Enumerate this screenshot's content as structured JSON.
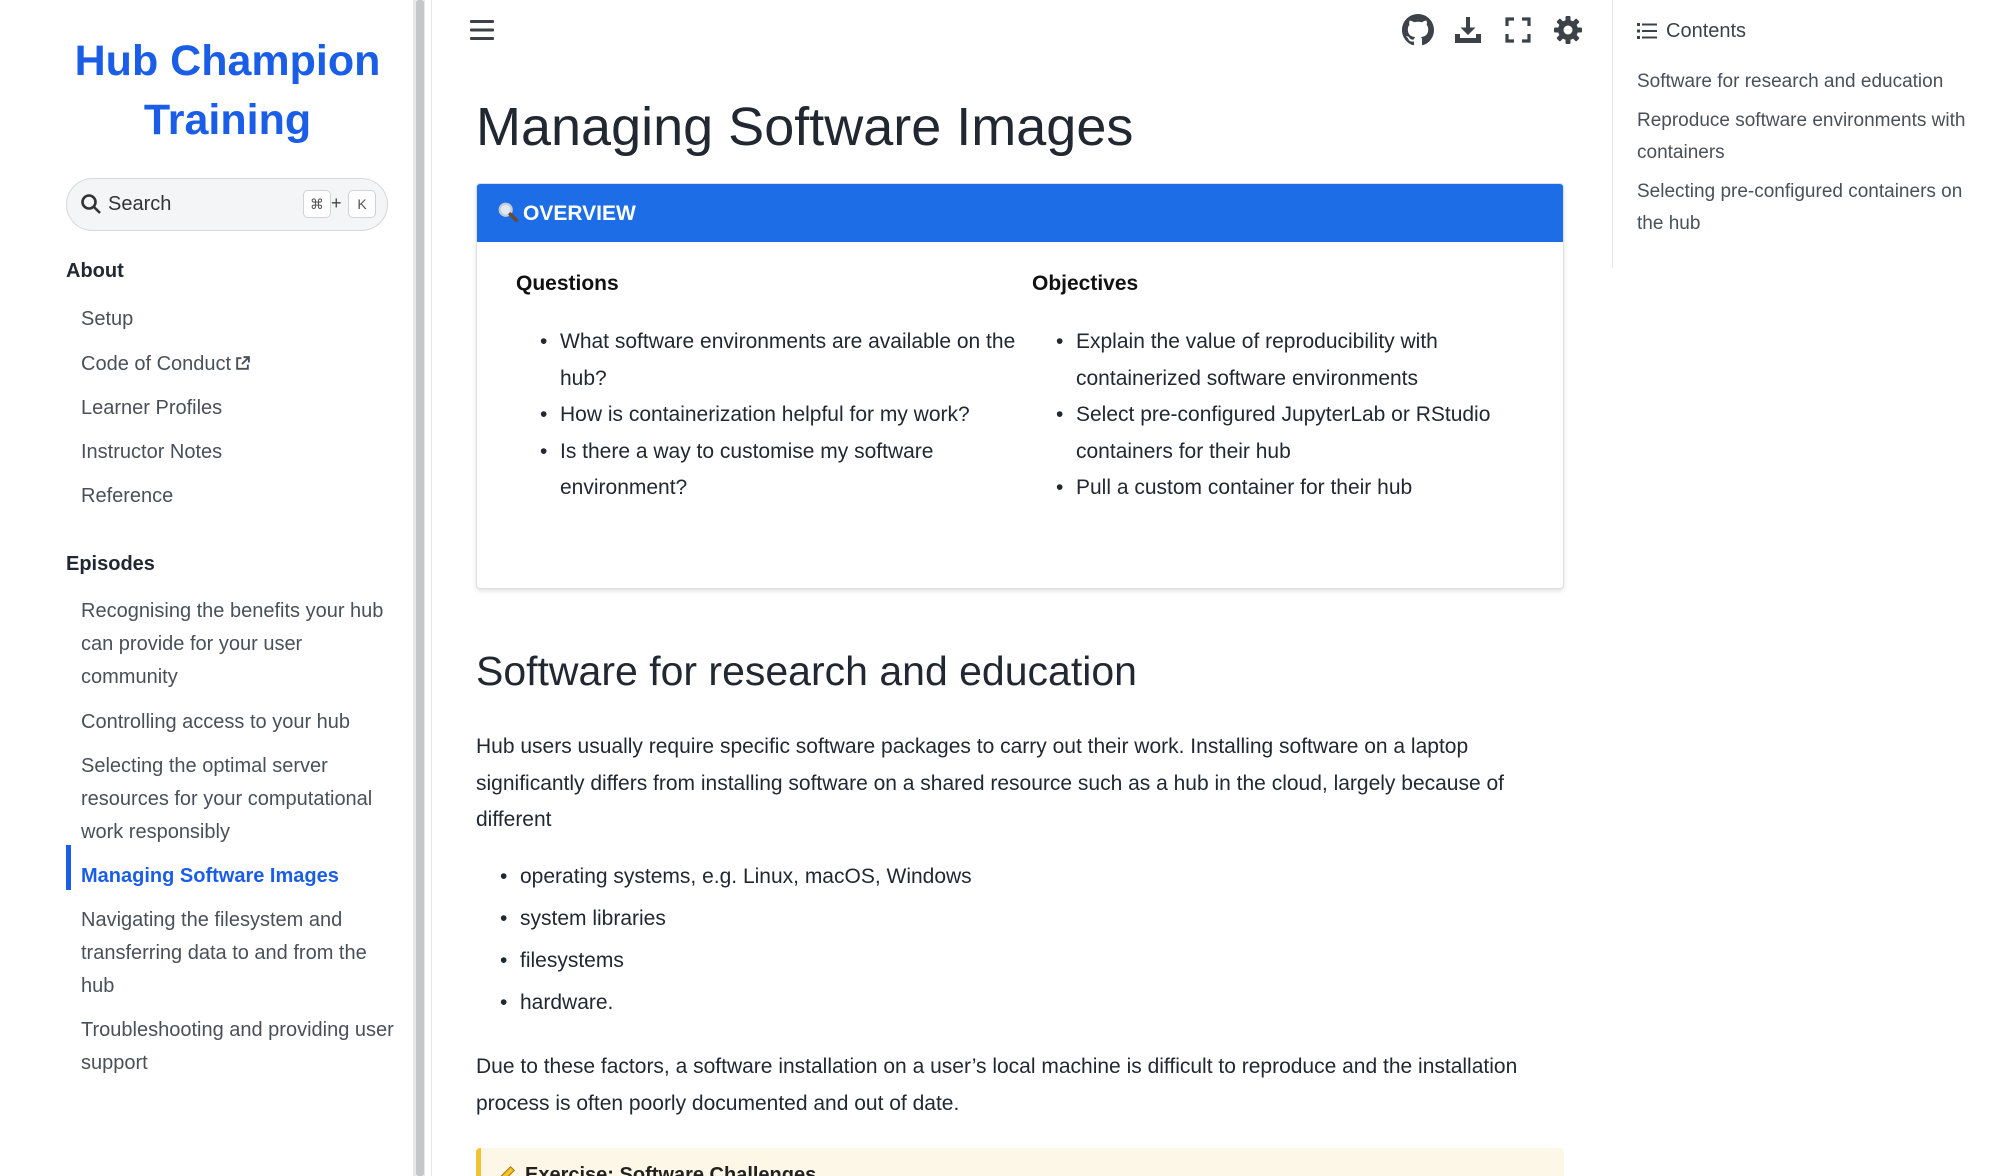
{
  "sidebar": {
    "logo": "Hub Champion Training",
    "search": {
      "label": "Search",
      "shortcut_mod": "⌘",
      "shortcut_plus": "+",
      "shortcut_key": "K"
    },
    "sections": [
      {
        "caption": "About",
        "items": [
          "Setup",
          "Code of Conduct",
          "Learner Profiles",
          "Instructor Notes",
          "Reference"
        ]
      },
      {
        "caption": "Episodes",
        "items": [
          "Recognising the benefits your hub can provide for your user community",
          "Controlling access to your hub",
          "Selecting the optimal server resources for your computational work responsibly",
          "Managing Software Images",
          "Navigating the filesystem and transferring data to and from the hub",
          "Troubleshooting and providing user support"
        ]
      }
    ],
    "active_item": "Managing Software Images"
  },
  "header": {
    "icons": [
      "menu-icon",
      "github-icon",
      "download-icon",
      "fullscreen-icon",
      "theme-toggle-icon"
    ]
  },
  "main": {
    "title": "Managing Software Images",
    "overview": {
      "label": "OVERVIEW",
      "questions_heading": "Questions",
      "questions": [
        "What software environments are available on the hub?",
        "How is containerization helpful for my work?",
        "Is there a way to customise my software environment?"
      ],
      "objectives_heading": "Objectives",
      "objectives": [
        "Explain the value of reproducibility with containerized software environments",
        "Select pre-configured JupyterLab or RStudio containers for their hub",
        "Pull a custom container for their hub"
      ]
    },
    "section_heading": "Software for research and education",
    "intro_paragraph": "Hub users usually require specific software packages to carry out their work. Installing software on a laptop significantly differs from installing software on a shared resource such as a hub in the cloud, largely because of different",
    "factors": [
      "operating systems, e.g. Linux, macOS, Windows",
      "system libraries",
      "filesystems",
      "hardware."
    ],
    "conclusion_paragraph": "Due to these factors, a software installation on a user’s local machine is difficult to reproduce and the installation process is often poorly documented and out of date.",
    "exercise_title": "Exercise: Software Challenges"
  },
  "toc": {
    "heading": "Contents",
    "items": [
      "Software for research and education",
      "Reproduce software environments with containers",
      "Selecting pre-configured containers on the hub"
    ]
  },
  "colors": {
    "accent": "#1a5ee8",
    "overview_header": "#1c6de6",
    "text": "#222832",
    "muted": "#4a5058",
    "exercise_bg": "#fdf7e8",
    "exercise_border": "#f1c232"
  }
}
